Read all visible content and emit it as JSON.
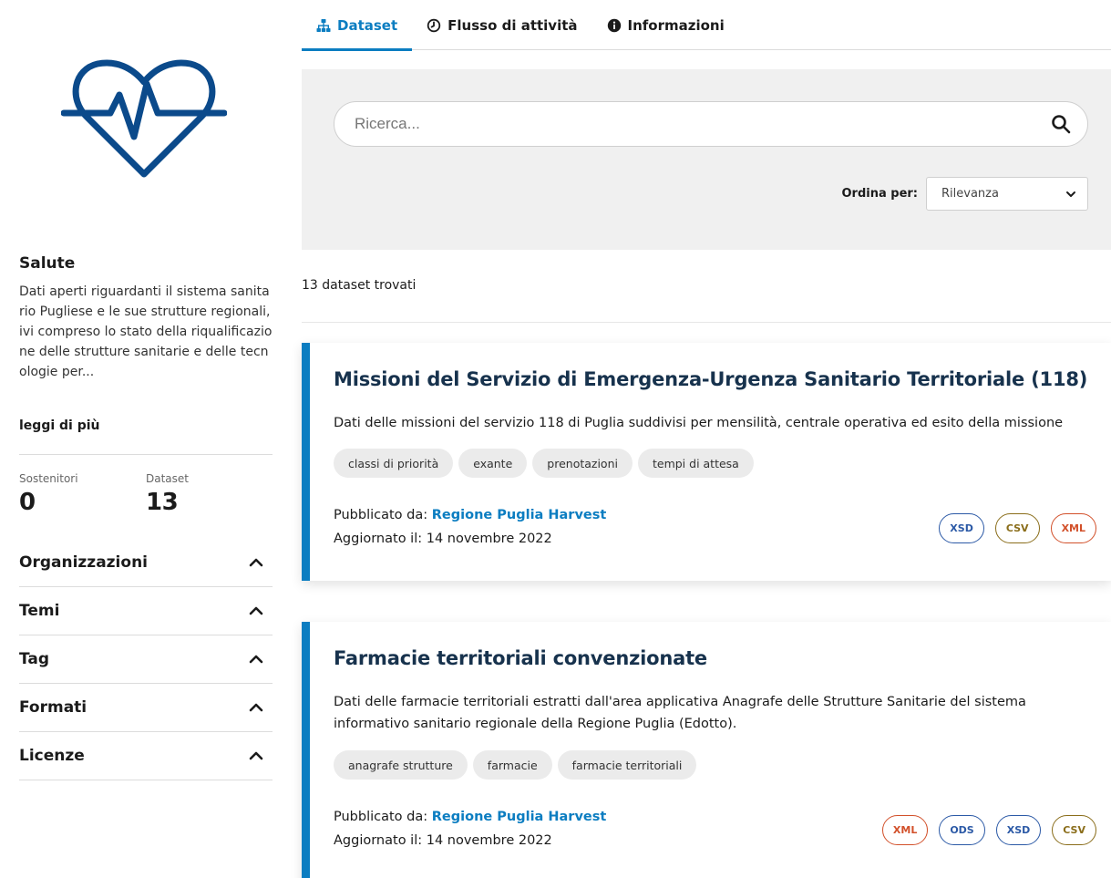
{
  "group": {
    "title": "Salute",
    "description": "Dati aperti riguardanti il sistema sanitario Pugliese e le sue strutture regionali, ivi compreso lo stato della riqualificazione delle strutture sanitarie e delle tecnologie per...",
    "read_more": "leggi di più",
    "icon": "heartbeat-icon",
    "icon_color": "#0b4a8b"
  },
  "stats": {
    "followers_label": "Sostenitori",
    "followers_value": "0",
    "datasets_label": "Dataset",
    "datasets_value": "13"
  },
  "facets": [
    {
      "label": "Organizzazioni",
      "expanded": true
    },
    {
      "label": "Temi",
      "expanded": true
    },
    {
      "label": "Tag",
      "expanded": true
    },
    {
      "label": "Formati",
      "expanded": true
    },
    {
      "label": "Licenze",
      "expanded": true
    }
  ],
  "tabs": [
    {
      "label": "Dataset",
      "icon": "sitemap-icon",
      "active": true
    },
    {
      "label": "Flusso di attività",
      "icon": "clock-icon",
      "active": false
    },
    {
      "label": "Informazioni",
      "icon": "info-icon",
      "active": false
    }
  ],
  "search": {
    "placeholder": "Ricerca...",
    "value": "",
    "order_label": "Ordina per:",
    "order_value": "Rilevanza"
  },
  "results": {
    "count_text": "13 dataset trovati",
    "items": [
      {
        "title": "Missioni del Servizio di Emergenza-Urgenza Sanitario Territoriale (118)",
        "description": "Dati delle missioni del servizio 118 di Puglia suddivisi per mensilità, centrale operativa ed esito della missione",
        "tags": [
          "classi di priorità",
          "exante",
          "prenotazioni",
          "tempi di attesa"
        ],
        "published_label": "Pubblicato da:",
        "publisher": "Regione Puglia Harvest",
        "updated_text": "Aggiornato il: 14 novembre 2022",
        "formats": [
          "XSD",
          "CSV",
          "XML"
        ]
      },
      {
        "title": "Farmacie territoriali convenzionate",
        "description": "Dati delle farmacie territoriali estratti dall'area applicativa Anagrafe delle Strutture Sanitarie del sistema informativo sanitario regionale della Regione Puglia (Edotto).",
        "tags": [
          "anagrafe strutture",
          "farmacie",
          "farmacie territoriali"
        ],
        "published_label": "Pubblicato da:",
        "publisher": "Regione Puglia Harvest",
        "updated_text": "Aggiornato il: 14 novembre 2022",
        "formats": [
          "XML",
          "ODS",
          "XSD",
          "CSV"
        ]
      }
    ]
  },
  "colors": {
    "accent": "#0b7dc1",
    "title": "#17324d",
    "panel_bg": "#f0f0f0"
  }
}
